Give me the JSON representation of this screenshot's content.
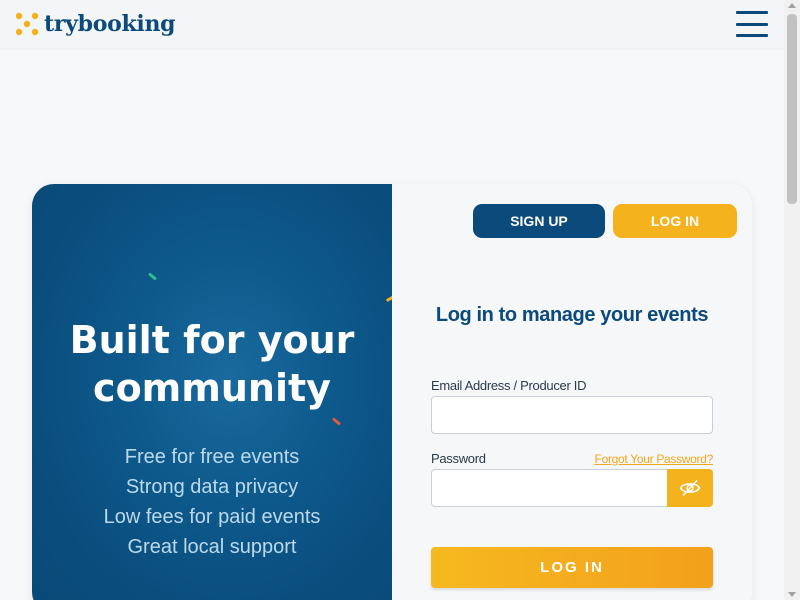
{
  "header": {
    "logo_text": "trybooking",
    "menu_icon": "hamburger-menu-icon"
  },
  "hero": {
    "heading_line1": "Built for your",
    "heading_line2": "community",
    "features": [
      "Free for free events",
      "Strong data privacy",
      "Low fees for paid events",
      "Great local support"
    ]
  },
  "auth": {
    "signup_tab": "SIGN UP",
    "login_tab": "LOG IN",
    "title": "Log in to manage your events",
    "email_label": "Email Address / Producer ID",
    "email_value": "",
    "password_label": "Password",
    "password_value": "",
    "forgot_link": "Forgot Your Password?",
    "submit_label": "LOG IN",
    "eye_icon": "eye-slash-icon"
  },
  "colors": {
    "brand_navy": "#0b4a7b",
    "brand_yellow": "#f4b21d",
    "hero_blue": "#0e5a8d"
  }
}
